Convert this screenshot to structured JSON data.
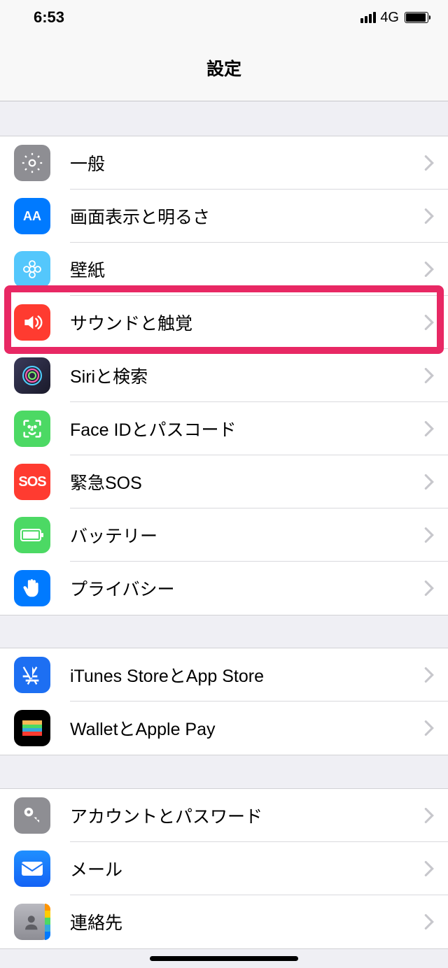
{
  "status": {
    "time": "6:53",
    "network": "4G"
  },
  "header": {
    "title": "設定"
  },
  "groups": [
    {
      "rows": [
        {
          "id": "general",
          "label": "一般"
        },
        {
          "id": "display",
          "label": "画面表示と明るさ"
        },
        {
          "id": "wallpaper",
          "label": "壁紙"
        },
        {
          "id": "sounds",
          "label": "サウンドと触覚"
        },
        {
          "id": "siri",
          "label": "Siriと検索"
        },
        {
          "id": "faceid",
          "label": "Face IDとパスコード"
        },
        {
          "id": "sos",
          "label": "緊急SOS"
        },
        {
          "id": "battery",
          "label": "バッテリー"
        },
        {
          "id": "privacy",
          "label": "プライバシー"
        }
      ]
    },
    {
      "rows": [
        {
          "id": "itunes",
          "label": "iTunes StoreとApp Store"
        },
        {
          "id": "wallet",
          "label": "WalletとApple Pay"
        }
      ]
    },
    {
      "rows": [
        {
          "id": "accounts",
          "label": "アカウントとパスワード"
        },
        {
          "id": "mail",
          "label": "メール"
        },
        {
          "id": "contacts",
          "label": "連絡先"
        }
      ]
    }
  ],
  "highlighted_row": "sounds",
  "sos_icon_text": "SOS",
  "aa_icon_text": "AA"
}
